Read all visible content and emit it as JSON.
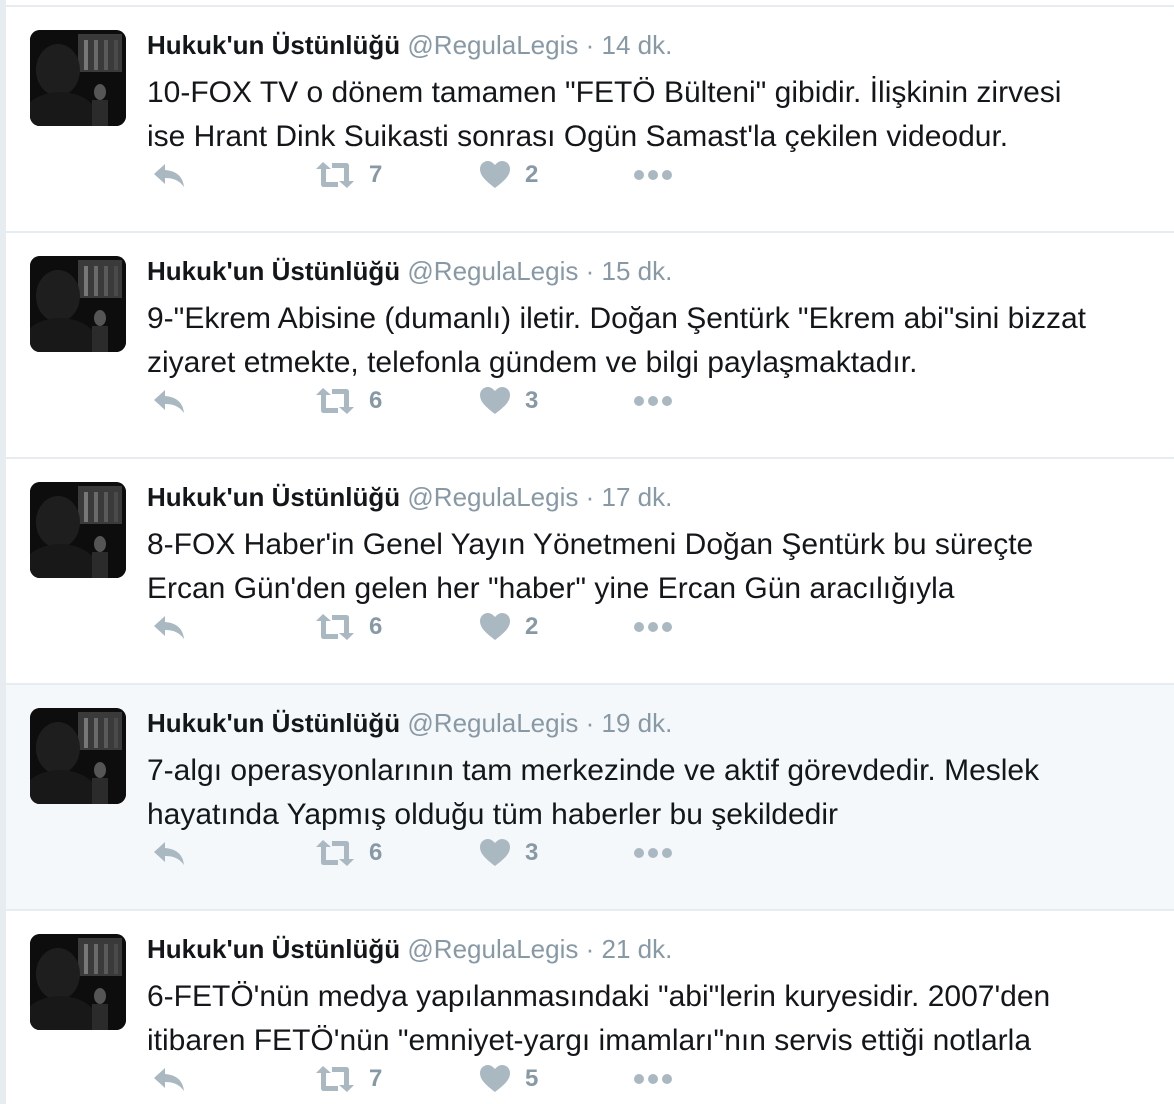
{
  "tweets": [
    {
      "fullname": "Hukuk'un Üstünlüğü",
      "username": "@RegulaLegis",
      "separator": "·",
      "time": "14 dk.",
      "lines": [
        "10-FOX TV o dönem tamamen \"FETÖ Bülteni\" gibidir. İlişkinin zirvesi",
        "ise Hrant Dink Suikasti sonrası Ogün Samast'la çekilen videodur."
      ],
      "retweets": "7",
      "likes": "2"
    },
    {
      "fullname": "Hukuk'un Üstünlüğü",
      "username": "@RegulaLegis",
      "separator": "·",
      "time": "15 dk.",
      "lines": [
        "9-\"Ekrem Abisine (dumanlı) iletir. Doğan Şentürk \"Ekrem abi\"sini bizzat",
        "ziyaret etmekte, telefonla gündem ve bilgi paylaşmaktadır."
      ],
      "retweets": "6",
      "likes": "3"
    },
    {
      "fullname": "Hukuk'un Üstünlüğü",
      "username": "@RegulaLegis",
      "separator": "·",
      "time": "17 dk.",
      "lines": [
        "8-FOX Haber'in Genel Yayın Yönetmeni Doğan Şentürk bu süreçte",
        "Ercan Gün'den gelen her \"haber\" yine Ercan Gün aracılığıyla"
      ],
      "retweets": "6",
      "likes": "2"
    },
    {
      "fullname": "Hukuk'un Üstünlüğü",
      "username": "@RegulaLegis",
      "separator": "·",
      "time": "19 dk.",
      "lines": [
        "7-algı operasyonlarının tam merkezinde ve aktif görevdedir. Meslek",
        "hayatında Yapmış olduğu tüm haberler bu şekildedir"
      ],
      "retweets": "6",
      "likes": "3"
    },
    {
      "fullname": "Hukuk'un Üstünlüğü",
      "username": "@RegulaLegis",
      "separator": "·",
      "time": "21 dk.",
      "lines": [
        "6-FETÖ'nün medya yapılanmasındaki \"abi\"lerin kuryesidir. 2007'den",
        "itibaren FETÖ'nün \"emniyet-yargı imamları\"nın servis ettiği notlarla"
      ],
      "retweets": "7",
      "likes": "5"
    }
  ],
  "icons": {
    "reply": "reply-icon",
    "retweet": "retweet-icon",
    "like": "heart-icon",
    "more": "more-dots-icon"
  },
  "colors": {
    "name": "#14171a",
    "muted": "#8899a6",
    "icon": "#aab8c2",
    "hover_bg": "#f5f8fa",
    "divider": "#e6ecf0"
  }
}
